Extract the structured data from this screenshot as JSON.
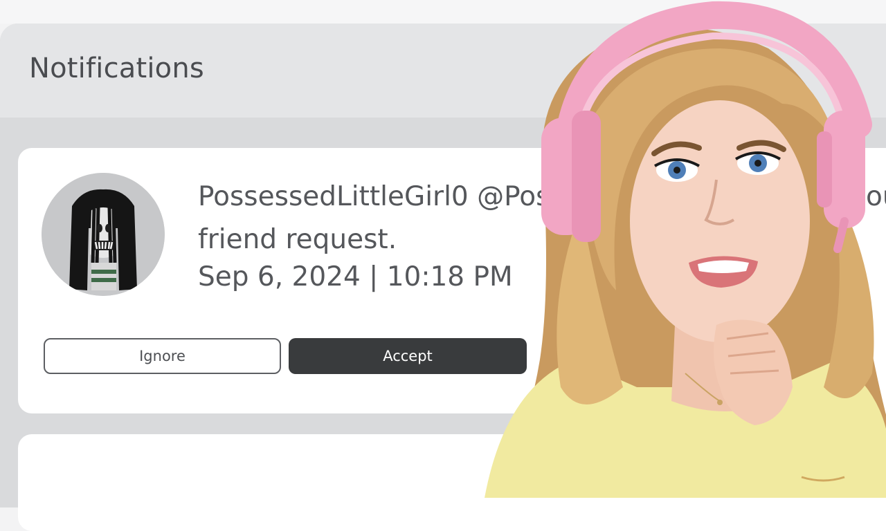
{
  "panel": {
    "title": "Notifications"
  },
  "notification": {
    "message": "PossessedLittleGirl0 @PossessedLittleGirl0 sent you a friend request.",
    "timestamp": "Sep 6, 2024 | 10:18 PM",
    "ignore_label": "Ignore",
    "accept_label": "Accept"
  },
  "colors": {
    "accept_button": "#393b3d",
    "panel_background": "#d9dadc",
    "card_background": "#ffffff",
    "headphones_pink": "#f2a6c4"
  },
  "icons": {
    "avatar": "horror-girl-avatar"
  }
}
